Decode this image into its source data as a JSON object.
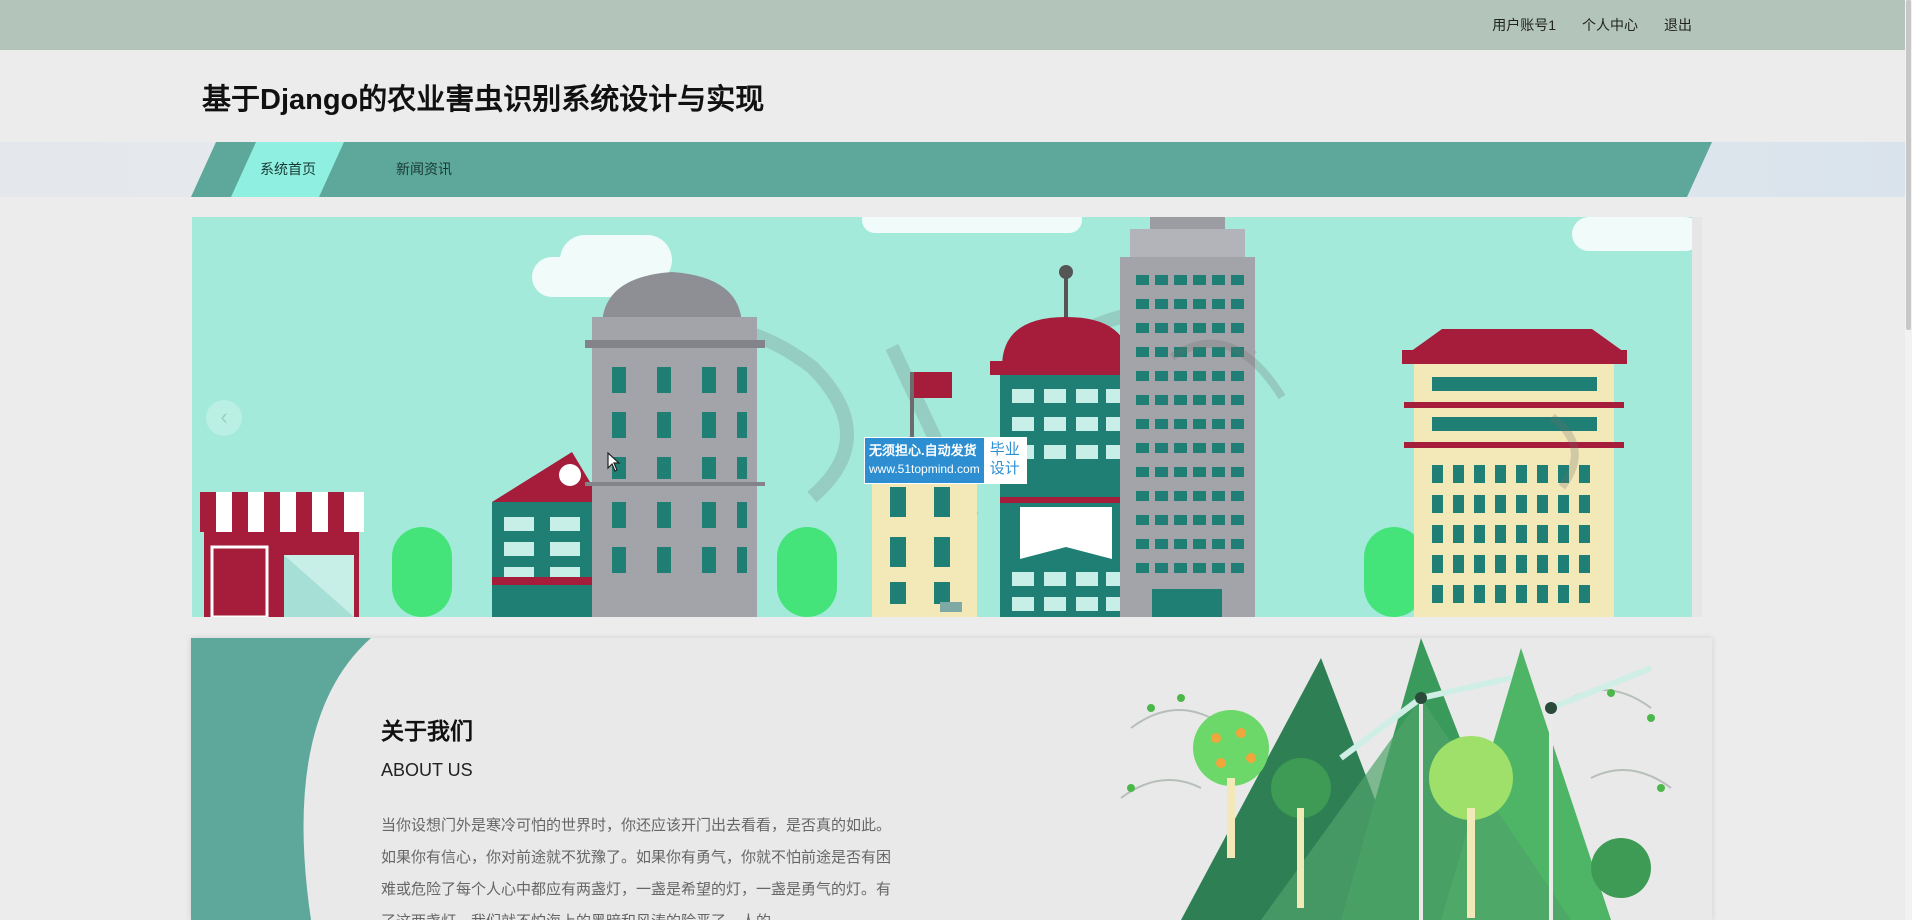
{
  "topbar": {
    "links": [
      {
        "label": "用户账号1"
      },
      {
        "label": "个人中心"
      },
      {
        "label": "退出"
      }
    ]
  },
  "header": {
    "title": "基于Django的农业害虫识别系统设计与实现"
  },
  "nav": {
    "items": [
      {
        "label": "系统首页",
        "active": true
      },
      {
        "label": "新闻资讯",
        "active": false
      }
    ]
  },
  "banner": {
    "prev_icon": "chevron-left-icon",
    "prev_glyph": "‹",
    "watermark": {
      "line1": "无须担心.自动发货",
      "line2": "www.51topmind.com",
      "tag_line1": "毕业",
      "tag_line2": "设计"
    }
  },
  "about": {
    "title": "关于我们",
    "subtitle": "ABOUT US",
    "text": "当你设想门外是寒冷可怕的世界时，你还应该开门出去看看，是否真的如此。如果你有信心，你对前途就不犹豫了。如果你有勇气，你就不怕前途是否有困难或危险了每个人心中都应有两盏灯，一盏是希望的灯，一盏是勇气的灯。有了这两盏灯，我们就不怕海上的黑暗和风涛的险恶了。人的"
  },
  "colors": {
    "topbar": "#b3c5bb",
    "nav": "#5ea79b",
    "nav_active": "#8fefe0",
    "banner_bg": "#a3eadb",
    "building_red": "#a61d3b",
    "building_teal": "#1f7f74",
    "watermark_blue": "#2d8fd1"
  }
}
